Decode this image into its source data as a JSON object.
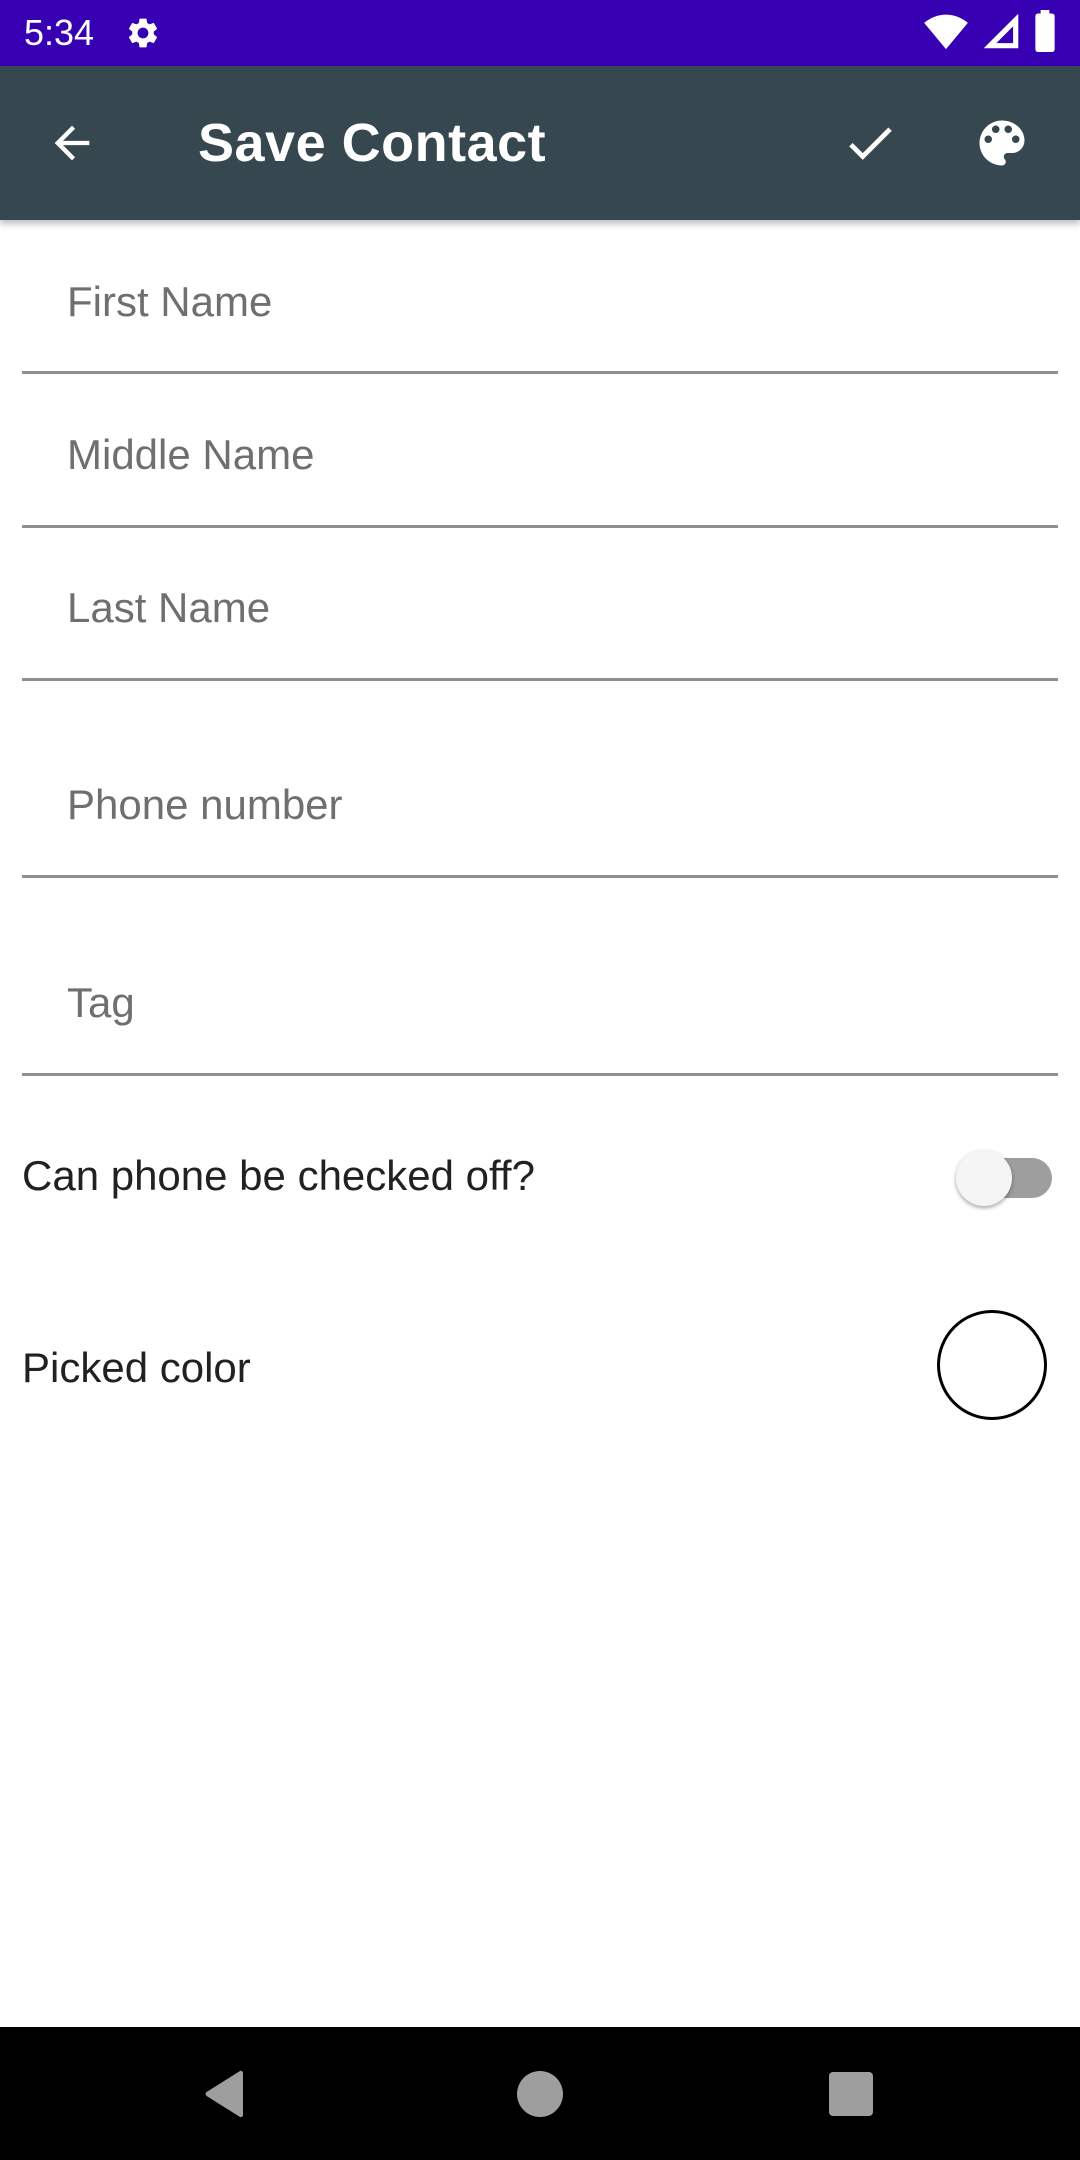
{
  "status_bar": {
    "time": "5:34",
    "background": "#3700B3",
    "icons": [
      "gear-icon",
      "wifi-icon",
      "cellular-signal-icon",
      "battery-icon"
    ]
  },
  "app_bar": {
    "title": "Save Contact",
    "background": "#37474F",
    "back_icon": "arrow-back-icon",
    "actions": [
      "check-icon",
      "palette-icon"
    ]
  },
  "form": {
    "first_name": {
      "placeholder": "First Name",
      "value": ""
    },
    "middle_name": {
      "placeholder": "Middle Name",
      "value": ""
    },
    "last_name": {
      "placeholder": "Last Name",
      "value": ""
    },
    "phone_number": {
      "placeholder": "Phone number",
      "value": ""
    },
    "tag": {
      "placeholder": "Tag",
      "value": ""
    }
  },
  "checkoff_toggle": {
    "label": "Can phone be checked off?",
    "checked": false
  },
  "color_picker": {
    "label": "Picked color",
    "color": "#FFFFFF"
  },
  "navigation_bar": {
    "buttons": [
      "nav-back-icon",
      "nav-home-icon",
      "nav-recents-icon"
    ]
  }
}
